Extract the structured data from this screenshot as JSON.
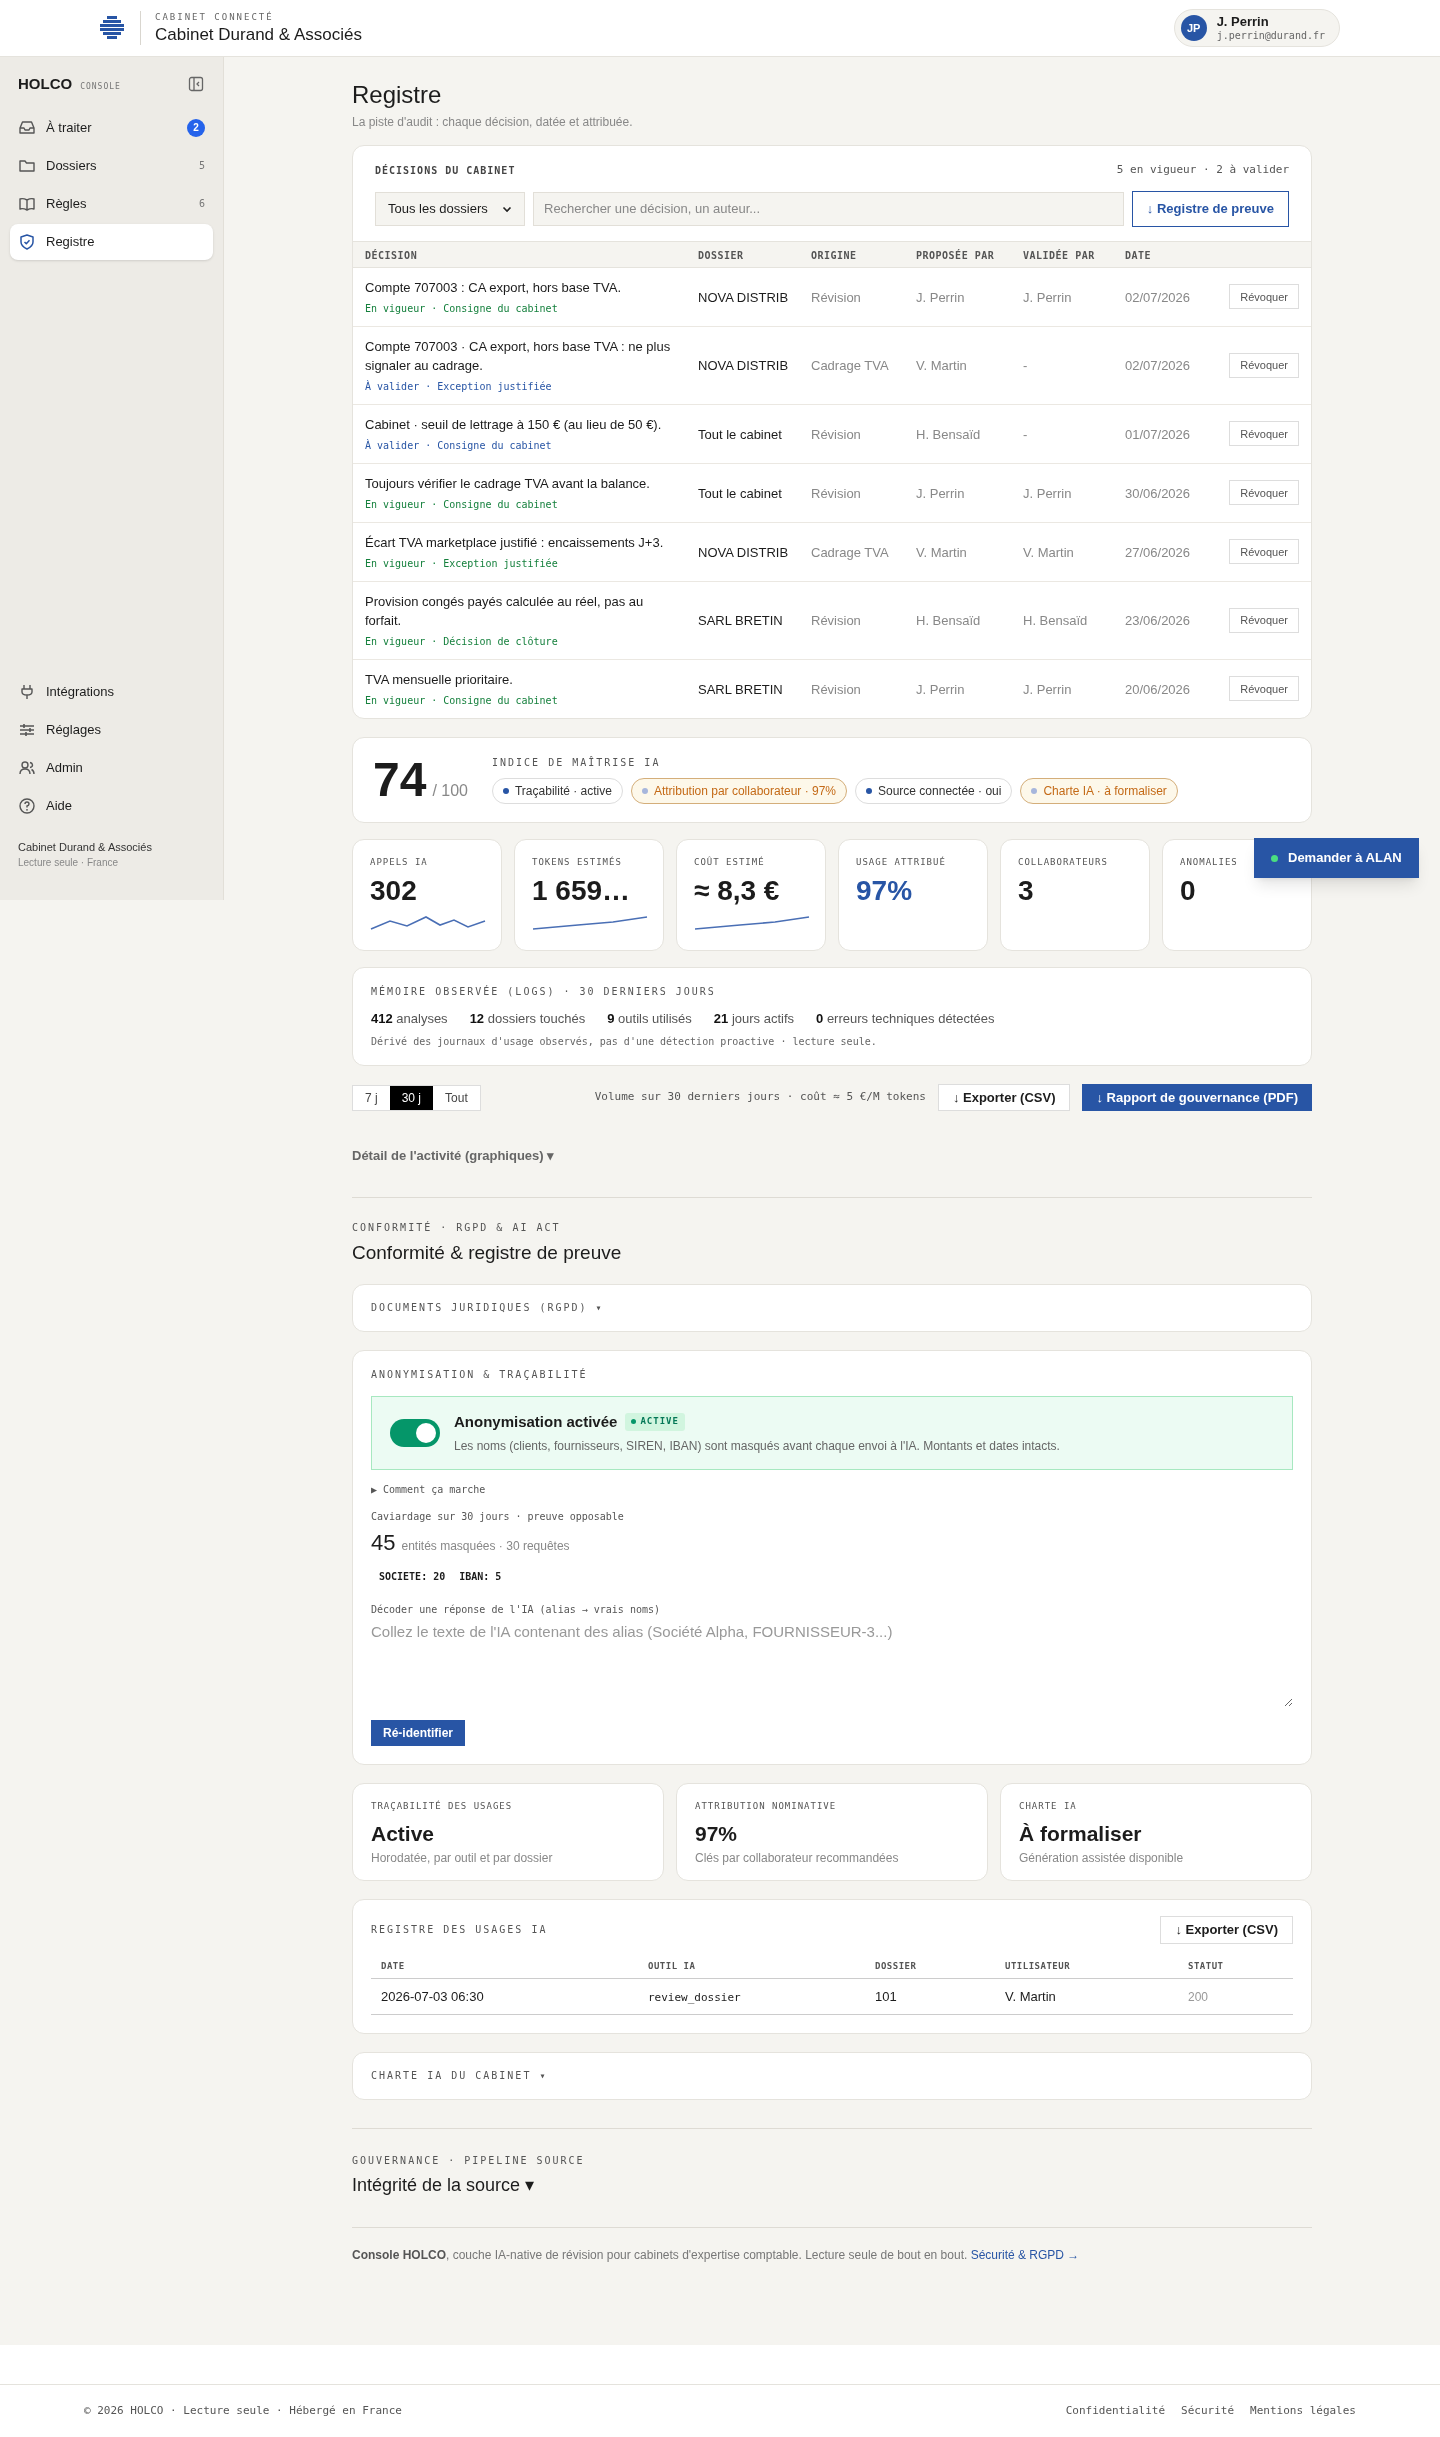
{
  "header": {
    "kicker": "CABINET CONNECTÉ",
    "title": "Cabinet Durand & Associés",
    "user": {
      "initials": "JP",
      "name": "J. Perrin",
      "email": "j.perrin@durand.fr"
    }
  },
  "sidebar": {
    "brand": "HOLCO",
    "brand_tag": "CONSOLE",
    "items": [
      {
        "kind": "inbox",
        "label": "À traiter",
        "badge": "2",
        "selected": false
      },
      {
        "kind": "folder",
        "label": "Dossiers",
        "count": "5",
        "selected": false
      },
      {
        "kind": "book",
        "label": "Règles",
        "count": "6",
        "selected": false
      },
      {
        "kind": "shield",
        "label": "Registre",
        "selected": true
      }
    ],
    "bottom_items": [
      {
        "kind": "plug",
        "label": "Intégrations"
      },
      {
        "kind": "sliders",
        "label": "Réglages"
      },
      {
        "kind": "users",
        "label": "Admin"
      },
      {
        "kind": "help",
        "label": "Aide"
      }
    ],
    "org": {
      "name": "Cabinet Durand & Associés",
      "note": "Lecture seule · France"
    }
  },
  "page": {
    "title": "Registre",
    "subtitle": "La piste d'audit : chaque décision, datée et attribuée."
  },
  "decisions": {
    "title": "DÉCISIONS DU CABINET",
    "summary": "5 en vigueur · 2 à valider",
    "filter": "Tous les dossiers",
    "search_placeholder": "Rechercher une décision, un auteur...",
    "proof_button": "↓ Registre de preuve",
    "columns": [
      "DÉCISION",
      "DOSSIER",
      "ORIGINE",
      "PROPOSÉE PAR",
      "VALIDÉE PAR",
      "DATE"
    ],
    "rows": [
      {
        "decision": "Compte 707003 : CA export, hors base TVA.",
        "tag": "En vigueur · Consigne du cabinet",
        "color": "#15803d",
        "dossier": "NOVA DISTRIB",
        "origine": "Révision",
        "proposee_par": "J. Perrin",
        "validee_par": "J. Perrin",
        "date": "02/07/2026",
        "action": "Révoquer"
      },
      {
        "decision": "Compte 707003 · CA export, hors base TVA : ne plus signaler au cadrage.",
        "tag": "À valider · Exception justifiée",
        "color": "#2855a5",
        "dossier": "NOVA DISTRIB",
        "origine": "Cadrage TVA",
        "proposee_par": "V. Martin",
        "validee_par": "-",
        "date": "02/07/2026",
        "action": "Révoquer"
      },
      {
        "decision": "Cabinet · seuil de lettrage à 150 € (au lieu de 50 €).",
        "tag": "À valider · Consigne du cabinet",
        "color": "#2855a5",
        "dossier": "Tout le cabinet",
        "origine": "Révision",
        "proposee_par": "H. Bensaïd",
        "validee_par": "-",
        "date": "01/07/2026",
        "action": "Révoquer"
      },
      {
        "decision": "Toujours vérifier le cadrage TVA avant la balance.",
        "tag": "En vigueur · Consigne du cabinet",
        "color": "#15803d",
        "dossier": "Tout le cabinet",
        "origine": "Révision",
        "proposee_par": "J. Perrin",
        "validee_par": "J. Perrin",
        "date": "30/06/2026",
        "action": "Révoquer"
      },
      {
        "decision": "Écart TVA marketplace justifié : encaissements J+3.",
        "tag": "En vigueur · Exception justifiée",
        "color": "#15803d",
        "dossier": "NOVA DISTRIB",
        "origine": "Cadrage TVA",
        "proposee_par": "V. Martin",
        "validee_par": "V. Martin",
        "date": "27/06/2026",
        "action": "Révoquer"
      },
      {
        "decision": "Provision congés payés calculée au réel, pas au forfait.",
        "tag": "En vigueur · Décision de clôture",
        "color": "#15803d",
        "dossier": "SARL BRETIN",
        "origine": "Révision",
        "proposee_par": "H. Bensaïd",
        "validee_par": "H. Bensaïd",
        "date": "23/06/2026",
        "action": "Révoquer"
      },
      {
        "decision": "TVA mensuelle prioritaire.",
        "tag": "En vigueur · Consigne du cabinet",
        "color": "#15803d",
        "dossier": "SARL BRETIN",
        "origine": "Révision",
        "proposee_par": "J. Perrin",
        "validee_par": "J. Perrin",
        "date": "20/06/2026",
        "action": "Révoquer"
      }
    ]
  },
  "score": {
    "value": "74",
    "max": "/ 100",
    "title": "INDICE DE MAÎTRISE IA",
    "chips": [
      {
        "label": "Traçabilité · active",
        "kind": "ok"
      },
      {
        "label": "Attribution par collaborateur · 97%",
        "kind": "warn"
      },
      {
        "label": "Source connectée · oui",
        "kind": "ok"
      },
      {
        "label": "Charte IA · à formaliser",
        "kind": "warn"
      }
    ]
  },
  "kpis": [
    {
      "label": "APPELS IA",
      "value": "302",
      "kind": "zigzag"
    },
    {
      "label": "TOKENS ESTIMÉS",
      "value": "1 659…",
      "kind": "trend"
    },
    {
      "label": "COÛT ESTIMÉ",
      "value": "≈ 8,3 €",
      "kind": "trend"
    },
    {
      "label": "USAGE ATTRIBUÉ",
      "value": "97%",
      "kind": "accent"
    },
    {
      "label": "COLLABORATEURS",
      "value": "3",
      "kind": "plain"
    },
    {
      "label": "ANOMALIES",
      "value": "0",
      "kind": "plain"
    }
  ],
  "fab": {
    "label": "Demander à ALAN"
  },
  "memory": {
    "title": "MÉMOIRE OBSERVÉE (LOGS) · 30 DERNIERS JOURS",
    "stats": [
      "**412** analyses",
      "**12** dossiers touchés",
      "**9** outils utilisés",
      "**21** jours actifs",
      "**0** erreurs techniques détectées"
    ],
    "note": "Dérivé des journaux d'usage observés, pas d'une détection proactive · lecture seule."
  },
  "toolbar": {
    "ranges": [
      {
        "label": "7 j",
        "selected": false
      },
      {
        "label": "30 j",
        "selected": true
      },
      {
        "label": "Tout",
        "selected": false
      }
    ],
    "volume_note": "Volume sur 30 derniers jours · coût ≈ 5 €/M tokens",
    "export_button": "↓ Exporter (CSV)",
    "report_button": "↓ Rapport de gouvernance (PDF)"
  },
  "activity_toggle": "Détail de l'activité (graphiques) ▾",
  "compliance": {
    "kicker": "CONFORMITÉ · RGPD & AI ACT",
    "title": "Conformité & registre de preuve",
    "legal_docs": "DOCUMENTS JURIDIQUES (RGPD) ▾",
    "anonymization": {
      "title": "ANONYMISATION & TRAÇABILITÉ",
      "toggle_label": "Anonymisation activée",
      "on": true,
      "badge": "ACTIVE",
      "description": "Les noms (clients, fournisseurs, SIREN, IBAN) sont masqués avant chaque envoi à l'IA. Montants et dates intacts.",
      "how_it_works": "▶ Comment ça marche",
      "redaction_title": "Caviardage sur 30 jours · preuve opposable",
      "count": "45",
      "count_label": "entités masquées · 30 requêtes",
      "tags": [
        "SOCIETE: 20",
        "IBAN: 5"
      ],
      "decode_label": "Décoder une réponse de l'IA (alias → vrais noms)",
      "decode_placeholder": "Collez le texte de l'IA contenant des alias (Société Alpha, FOURNISSEUR-3...)",
      "reidentify_button": "Ré-identifier"
    },
    "summary_cards": [
      {
        "label": "TRAÇABILITÉ DES USAGES",
        "value": "Active",
        "note": "Horodatée, par outil et par dossier"
      },
      {
        "label": "ATTRIBUTION NOMINATIVE",
        "value": "97%",
        "note": "Clés par collaborateur recommandées"
      },
      {
        "label": "CHARTE IA",
        "value": "À formaliser",
        "note": "Génération assistée disponible"
      }
    ],
    "usage_log": {
      "title": "REGISTRE DES USAGES IA",
      "export_button": "↓ Exporter (CSV)",
      "columns": [
        "DATE",
        "OUTIL IA",
        "DOSSIER",
        "UTILISATEUR",
        "STATUT"
      ],
      "rows": [
        [
          "2026-07-03 06:30",
          "review_dossier",
          "101",
          "V. Martin",
          "200"
        ]
      ]
    },
    "charter": "CHARTE IA DU CABINET ▾"
  },
  "governance": {
    "kicker": "GOUVERNANCE · PIPELINE SOURCE",
    "title": "Intégrité de la source ▾"
  },
  "footer_note": {
    "text": "**Console HOLCO**, couche IA-native de révision pour cabinets d'expertise comptable. Lecture seule de bout en bout.",
    "link": "Sécurité & RGPD →"
  },
  "site_footer": {
    "copyright": "© 2026 HOLCO · Lecture seule · Hébergé en France",
    "links": [
      "Confidentialité",
      "Sécurité",
      "Mentions légales"
    ]
  }
}
